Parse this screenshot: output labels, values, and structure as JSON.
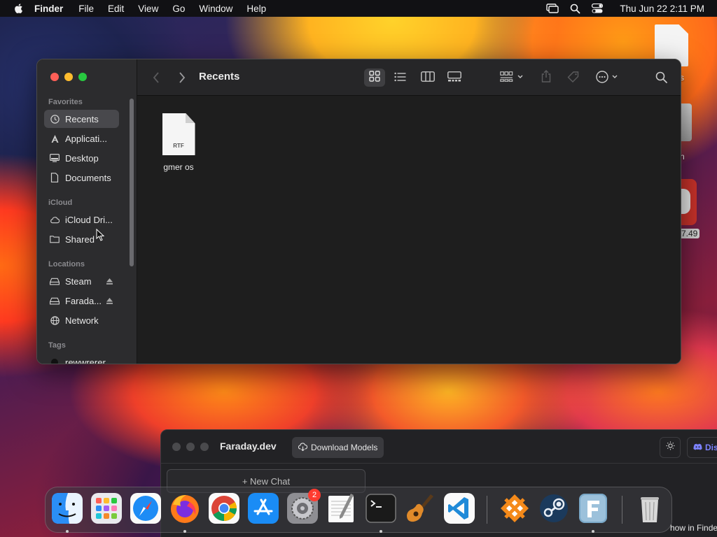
{
  "menubar": {
    "items": [
      "Finder",
      "File",
      "Edit",
      "View",
      "Go",
      "Window",
      "Help"
    ],
    "clock": "Thu Jun 22  2:11 PM",
    "icons": [
      "apple-icon",
      "screen-mirroring-icon",
      "spotlight-search-icon",
      "control-center-icon"
    ]
  },
  "desktop": {
    "label1": "s",
    "label2": "n",
    "label3": "7.49"
  },
  "finder": {
    "title": "Recents",
    "sidebar": {
      "favorites_heading": "Favorites",
      "icloud_heading": "iCloud",
      "locations_heading": "Locations",
      "tags_heading": "Tags",
      "favorites": [
        {
          "label": "Recents",
          "icon": "clock-icon",
          "selected": true
        },
        {
          "label": "Applicati...",
          "icon": "applications-icon"
        },
        {
          "label": "Desktop",
          "icon": "desktop-icon"
        },
        {
          "label": "Documents",
          "icon": "document-icon"
        }
      ],
      "icloud": [
        {
          "label": "iCloud Dri...",
          "icon": "cloud-icon"
        },
        {
          "label": "Shared",
          "icon": "shared-folder-icon"
        }
      ],
      "locations": [
        {
          "label": "Steam",
          "icon": "drive-icon",
          "ejectable": true
        },
        {
          "label": "Farada...",
          "icon": "drive-icon",
          "ejectable": true
        },
        {
          "label": "Network",
          "icon": "network-icon"
        }
      ],
      "tags": [
        {
          "label": "rewwrerer",
          "color": "#111111"
        }
      ]
    },
    "files": [
      {
        "name": "gmer os",
        "type": "RTF"
      }
    ]
  },
  "faraday": {
    "title": "Faraday.dev",
    "download_label": "Download Models",
    "new_chat_label": "+ New Chat",
    "discord_label": "Dis",
    "show_in_finder": "how in Finde"
  },
  "dock": {
    "apps": [
      {
        "name": "Finder",
        "icon": "finder-icon",
        "running": true
      },
      {
        "name": "Launchpad",
        "icon": "launchpad-icon"
      },
      {
        "name": "Safari",
        "icon": "safari-icon"
      },
      {
        "name": "Firefox",
        "icon": "firefox-icon",
        "running": true
      },
      {
        "name": "Chrome",
        "icon": "chrome-icon"
      },
      {
        "name": "App Store",
        "icon": "app-store-icon"
      },
      {
        "name": "System Settings",
        "icon": "system-settings-icon",
        "badge": "2"
      },
      {
        "name": "TextEdit",
        "icon": "textedit-icon"
      },
      {
        "name": "Terminal",
        "icon": "terminal-icon",
        "running": true
      },
      {
        "name": "GarageBand",
        "icon": "garageband-icon"
      },
      {
        "name": "Visual Studio Code",
        "icon": "vscode-icon"
      },
      {
        "name": "CrossOver",
        "icon": "crossover-icon"
      },
      {
        "name": "Steam",
        "icon": "steam-icon"
      },
      {
        "name": "Faraday",
        "icon": "faraday-icon",
        "running": true
      },
      {
        "name": "Trash",
        "icon": "trash-icon"
      }
    ]
  },
  "colors": {
    "accent": "#0a84ff",
    "close": "#ff5f57",
    "minimize": "#febc2e",
    "zoom": "#28c840",
    "badge": "#ff3b30"
  }
}
